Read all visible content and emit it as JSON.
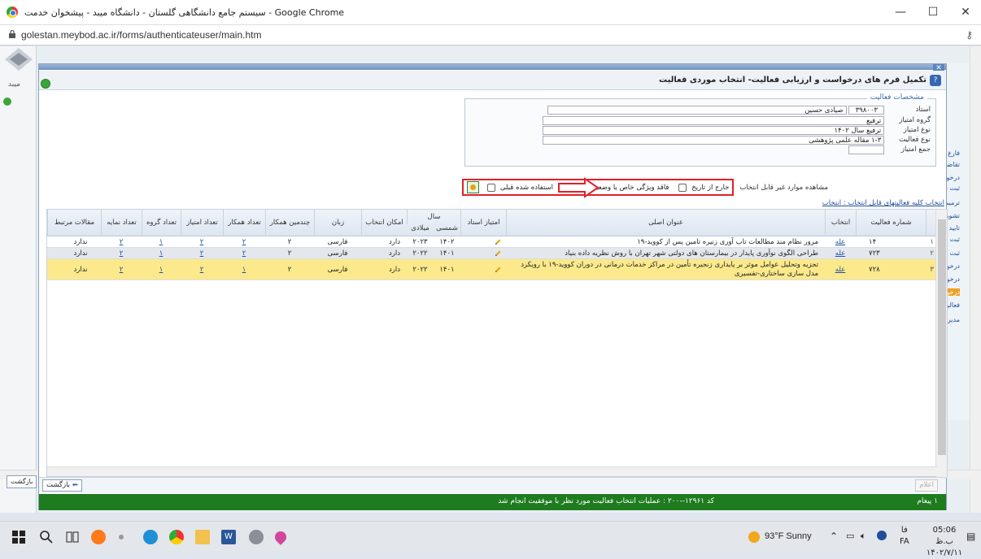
{
  "browser": {
    "window_title": "سیستم جامع دانشگاهی گلستان - دانشگاه میبد - پیشخوان خدمت - Google Chrome",
    "url": "golestan.meybod.ac.ir/forms/authenticateuser/main.htm"
  },
  "side": {
    "logo_text": "میبد",
    "links": [
      "فارغ ال",
      "تقاضای",
      "درخواست",
      "ثبت نام",
      "ترمیم",
      "تشویق",
      "تایید فعا",
      "ثبت و ت",
      "ثبت در",
      "درخواست",
      "درخواست",
      "درخواست",
      "فعالیت",
      "مدیر ی"
    ]
  },
  "dialog": {
    "title": "تکمیل فرم های درخواست و ارزیابی فعالیت- انتخاب موردی فعالیت",
    "specs": {
      "legend": "مشخصات فعالیت",
      "teacher_label": "استاد",
      "teacher_code": "۳۹۸۰۰۳",
      "teacher_name": "صیادی حسین",
      "points_group_label": "گروه امتیاز",
      "points_group_value": "ترفیع",
      "points_type_label": "نوع امتیاز",
      "points_type_value": "ترفیع سال ۱۴۰۲",
      "activity_type_label": "نوع فعالیت",
      "activity_type_value": "۱-۳ مقاله علمی پژوهشی",
      "total_label": "جمع امتیاز",
      "total_value": ""
    },
    "filters": {
      "label": "مشاهده موارد غیر قابل انتخاب",
      "out_of_date": "خارج از تاریخ",
      "special_feature": "فاقد ویژگی خاص یا وضعیت تایید",
      "previously_used": "استفاده شده قبلی"
    },
    "select_all": {
      "prefix": "انتخاب کلیه فعالیتهای قابل انتخاب",
      "link": "انتخاب"
    },
    "table": {
      "headers": {
        "rownum": "",
        "activity_no": "شماره فعالیت",
        "select": "انتخاب",
        "title": "عنوان اصلی",
        "teacher_points": "امتیاز استاد",
        "year": "سال",
        "year_shamsi": "شمسی",
        "year_miladi": "میلادی",
        "can_select": "امکان انتخاب",
        "language": "زبان",
        "nth_coauthor": "چندمین همکار",
        "coauthors_count": "تعداد همکار",
        "points_count": "تعداد امتیاز",
        "group_count": "تعداد گروه",
        "index_count": "تعداد نمایه",
        "related_articles": "مقالات مرتبط"
      },
      "rows": [
        {
          "num": "۱",
          "activity_no": "۱۴",
          "select": "عله",
          "title": "مرور نظام مند مطالعات تاب آوری زنیره تامین پس از کووید-۱۹",
          "shamsi": "۱۴۰۲",
          "miladi": "۲۰۲۳",
          "can_select": "دارد",
          "language": "فارسی",
          "nth": "۲",
          "coauthors": "۲",
          "points": "۲",
          "groups": "۱",
          "indexes": "۲",
          "related": "ندارد"
        },
        {
          "num": "۲",
          "activity_no": "۷۲۳",
          "select": "عله",
          "title": "طراحی الگوی نوآوری پایدار در بیمارستان های دولتی شهر تهران با روش نظریه داده بنیاد",
          "shamsi": "۱۴۰۱",
          "miladi": "۲۰۲۲",
          "can_select": "دارد",
          "language": "فارسی",
          "nth": "۲",
          "coauthors": "۲",
          "points": "۲",
          "groups": "۱",
          "indexes": "۲",
          "related": "ندارد"
        },
        {
          "num": "۳",
          "activity_no": "۷۲۸",
          "select": "عله",
          "title": "تجزیه وتحلیل عوامل موثر بر پایداری زنجیره تأمین در مراکز خدمات درمانی در دوران کووید-۱۹ با رویکرد مدل سازی ساختاری-تفسیری",
          "shamsi": "۱۴۰۱",
          "miladi": "۲۰۲۲",
          "can_select": "دارد",
          "language": "فارسی",
          "nth": "۲",
          "coauthors": "۱",
          "points": "۲",
          "groups": "۱",
          "indexes": "۲",
          "related": "ندارد"
        }
      ]
    },
    "footer": {
      "back_label": "بازگشت",
      "confirm_label": "اعلام",
      "status_message": "کد ۱۲۹۶۱--۲۰۰ : عملیات انتخاب فعالیت مورد نظر با موفقیت انجام شد",
      "message_count": "۱ پیغام"
    },
    "outer_back_label": "بازگشت"
  },
  "taskbar": {
    "weather": "93°F Sunny",
    "lang_top": "فا",
    "lang_bottom": "FA",
    "time": "05:06 ب.ظ",
    "date": "۱۴۰۲/۷/۱۱"
  }
}
